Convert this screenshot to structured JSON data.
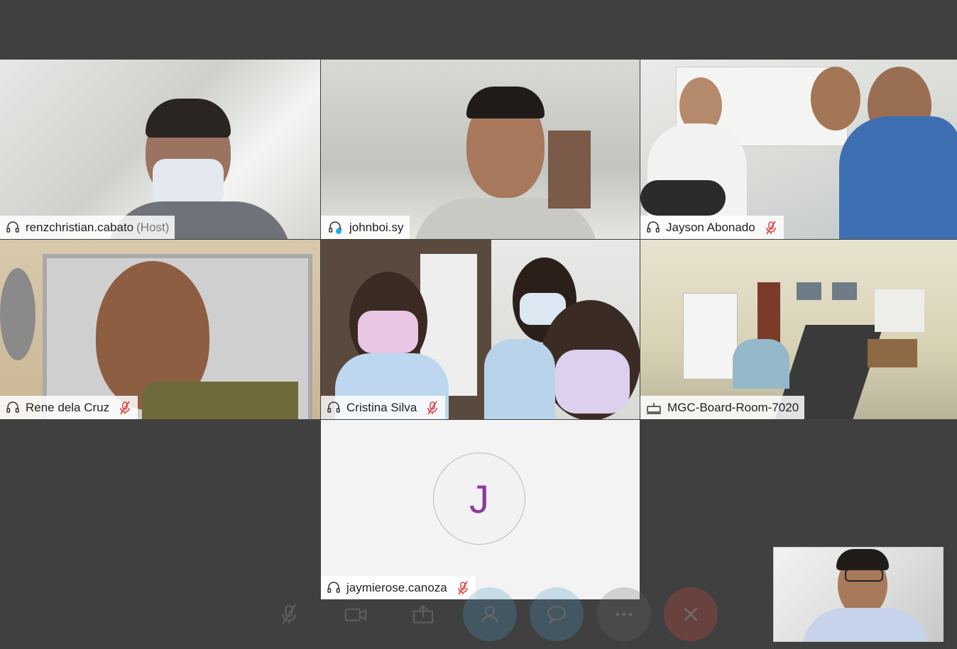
{
  "participants": [
    {
      "name": "renzchristian.cabato",
      "suffix": "(Host)",
      "muted": false,
      "audio_icon": "headset-icon"
    },
    {
      "name": "johnboi.sy",
      "suffix": "",
      "muted": false,
      "audio_icon": "headset-speaking-icon",
      "active_speaker": true
    },
    {
      "name": "Jayson Abonado",
      "suffix": "",
      "muted": true,
      "audio_icon": "headset-icon"
    },
    {
      "name": "Rene dela Cruz",
      "suffix": "",
      "muted": true,
      "audio_icon": "headset-icon"
    },
    {
      "name": "Cristina Silva",
      "suffix": "",
      "muted": true,
      "audio_icon": "headset-icon"
    },
    {
      "name": "MGC-Board-Room-7020",
      "suffix": "",
      "muted": false,
      "audio_icon": "room-device-icon"
    },
    {
      "name": "jaymierose.canoza",
      "suffix": "",
      "muted": true,
      "audio_icon": "headset-icon",
      "avatar_letter": "J"
    }
  ],
  "controls": [
    "mute-icon",
    "video-icon",
    "share-icon",
    "participants-icon",
    "chat-icon",
    "more-icon",
    "end-call-icon"
  ],
  "colors": {
    "active_border": "#19b4ec",
    "mute_red": "#e23b3b",
    "avatar_letter": "#8a3c9e",
    "background": "#404040"
  }
}
